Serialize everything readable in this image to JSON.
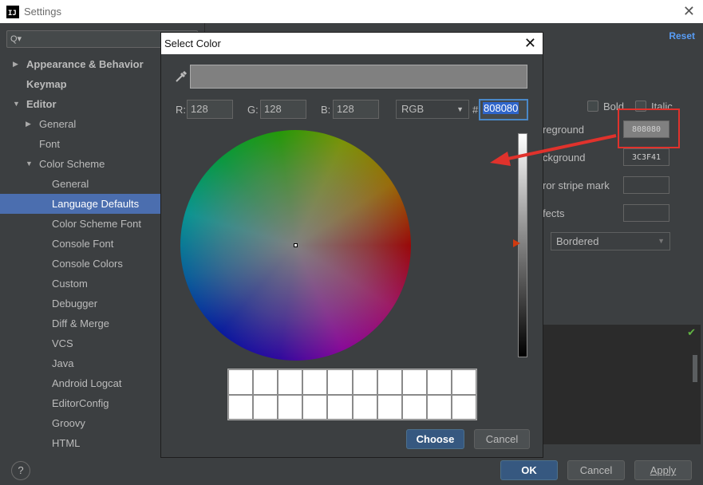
{
  "window": {
    "title": "Settings",
    "app_icon_text": "IJ"
  },
  "sidebar": {
    "search_placeholder": "Q▾",
    "items": [
      {
        "label": "Appearance & Behavior",
        "bold": true
      },
      {
        "label": "Keymap",
        "bold": true
      },
      {
        "label": "Editor",
        "bold": true
      },
      {
        "label": "General"
      },
      {
        "label": "Font"
      },
      {
        "label": "Color Scheme"
      },
      {
        "label": "General"
      },
      {
        "label": "Language Defaults",
        "selected": true
      },
      {
        "label": "Color Scheme Font"
      },
      {
        "label": "Console Font"
      },
      {
        "label": "Console Colors"
      },
      {
        "label": "Custom"
      },
      {
        "label": "Debugger"
      },
      {
        "label": "Diff & Merge"
      },
      {
        "label": "VCS"
      },
      {
        "label": "Java"
      },
      {
        "label": "Android Logcat"
      },
      {
        "label": "EditorConfig"
      },
      {
        "label": "Groovy"
      },
      {
        "label": "HTML"
      }
    ]
  },
  "panel": {
    "reset": "Reset",
    "bold_label": "Bold",
    "italic_label": "Italic",
    "foreground_label": "reground",
    "foreground_value": "808080",
    "background_label": "ckground",
    "background_value": "3C3F41",
    "error_stripe_label": "ror stripe mark",
    "effects_label": "fects",
    "effect_type": "Bordered"
  },
  "dialog": {
    "title": "Select Color",
    "r_label": "R:",
    "r_value": "128",
    "g_label": "G:",
    "g_value": "128",
    "b_label": "B:",
    "b_value": "128",
    "mode": "RGB",
    "hash": "#",
    "hex": "808080",
    "preview_color": "#808080",
    "brightness_level": 0.5,
    "choose": "Choose",
    "cancel": "Cancel"
  },
  "footer": {
    "help": "?",
    "ok": "OK",
    "cancel": "Cancel",
    "apply": "Apply"
  },
  "colors": {
    "selection": "#4b6eaf",
    "annotation_red": "#e0322c",
    "primary_button": "#365880",
    "link": "#589df6"
  }
}
